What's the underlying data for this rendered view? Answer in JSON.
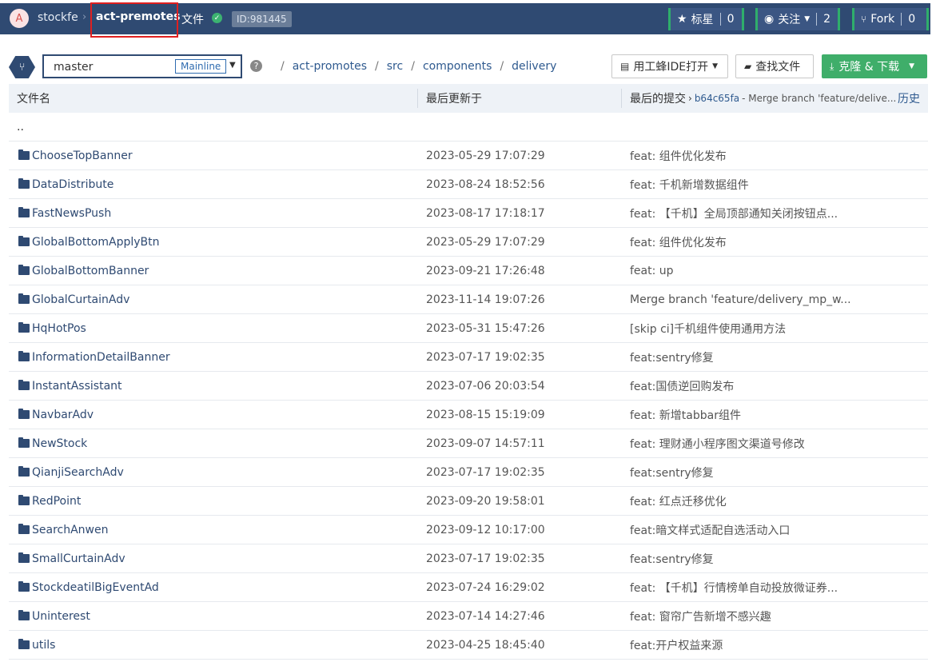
{
  "header": {
    "avatar_letter": "A",
    "owner": "stockfe",
    "separator": "›",
    "repo": "act-premotes",
    "section": "文件",
    "id_badge": "ID:981445",
    "star": {
      "label": "标星",
      "count": "0"
    },
    "watch": {
      "label": "关注",
      "count": "2"
    },
    "fork": {
      "label": "Fork",
      "count": "0"
    }
  },
  "toolbar": {
    "branch": "master",
    "branch_badge": "Mainline",
    "path": [
      "act-promotes",
      "src",
      "components",
      "delivery"
    ],
    "path_separator": "/",
    "ide_button": "用工蜂IDE打开",
    "find_button": "查找文件",
    "clone_button": "克隆 & 下载"
  },
  "table": {
    "col_name": "文件名",
    "col_updated": "最后更新于",
    "col_commit": "最后的提交",
    "last_commit_hash": "b64c65fa",
    "last_commit_msg": "- Merge branch 'feature/delive...",
    "history": "历史",
    "parent": "..",
    "rows": [
      {
        "name": "ChooseTopBanner",
        "date": "2023-05-29 17:07:29",
        "commit": "feat: 组件优化发布"
      },
      {
        "name": "DataDistribute",
        "date": "2023-08-24 18:52:56",
        "commit": "feat: 千机新增数据组件"
      },
      {
        "name": "FastNewsPush",
        "date": "2023-08-17 17:18:17",
        "commit": "feat: 【千机】全局顶部通知关闭按钮点..."
      },
      {
        "name": "GlobalBottomApplyBtn",
        "date": "2023-05-29 17:07:29",
        "commit": "feat: 组件优化发布"
      },
      {
        "name": "GlobalBottomBanner",
        "date": "2023-09-21 17:26:48",
        "commit": "feat: up"
      },
      {
        "name": "GlobalCurtainAdv",
        "date": "2023-11-14 19:07:26",
        "commit": "Merge branch 'feature/delivery_mp_w..."
      },
      {
        "name": "HqHotPos",
        "date": "2023-05-31 15:47:26",
        "commit": "[skip ci]千机组件使用通用方法"
      },
      {
        "name": "InformationDetailBanner",
        "date": "2023-07-17 19:02:35",
        "commit": "feat:sentry修复"
      },
      {
        "name": "InstantAssistant",
        "date": "2023-07-06 20:03:54",
        "commit": "feat:国债逆回购发布"
      },
      {
        "name": "NavbarAdv",
        "date": "2023-08-15 15:19:09",
        "commit": "feat: 新增tabbar组件"
      },
      {
        "name": "NewStock",
        "date": "2023-09-07 14:57:11",
        "commit": "feat: 理财通小程序图文渠道号修改"
      },
      {
        "name": "QianjiSearchAdv",
        "date": "2023-07-17 19:02:35",
        "commit": "feat:sentry修复"
      },
      {
        "name": "RedPoint",
        "date": "2023-09-20 19:58:01",
        "commit": "feat: 红点迁移优化"
      },
      {
        "name": "SearchAnwen",
        "date": "2023-09-12 10:17:00",
        "commit": "feat:暗文样式适配自选活动入口"
      },
      {
        "name": "SmallCurtainAdv",
        "date": "2023-07-17 19:02:35",
        "commit": "feat:sentry修复"
      },
      {
        "name": "StockdeatilBigEventAd",
        "date": "2023-07-24 16:29:02",
        "commit": "feat: 【千机】行情榜单自动投放微证券..."
      },
      {
        "name": "Uninterest",
        "date": "2023-07-14 14:27:46",
        "commit": "feat: 窗帘广告新增不感兴趣"
      },
      {
        "name": "utils",
        "date": "2023-04-25 18:45:40",
        "commit": "feat:开户权益来源"
      }
    ]
  },
  "colors": {
    "header_bg": "#2f4a72",
    "accent_green": "#3fae6a",
    "link_blue": "#2f5a8f",
    "highlight_red": "#e02020"
  }
}
